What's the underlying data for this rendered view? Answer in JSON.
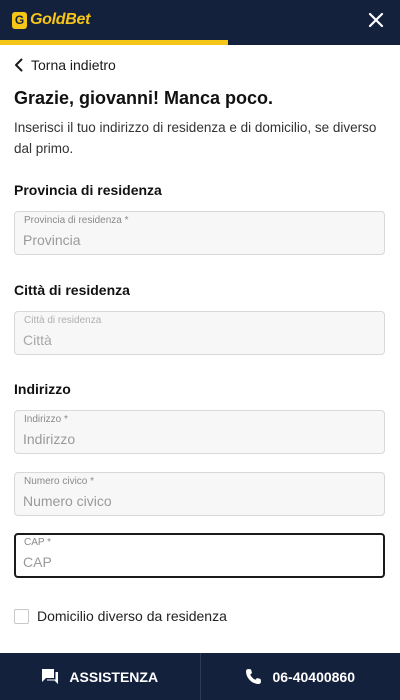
{
  "header": {
    "logo_badge": "G",
    "logo_text": "GoldBet",
    "progress_fraction": 0.57
  },
  "nav": {
    "back_label": "Torna indietro"
  },
  "intro": {
    "title": "Grazie, giovanni! Manca poco.",
    "subtitle": "Inserisci il tuo indirizzo di residenza e di domicilio, se diverso dal primo."
  },
  "sections": {
    "provincia": "Provincia di residenza",
    "citta": "Città di residenza",
    "indirizzo": "Indirizzo"
  },
  "fields": {
    "provincia": {
      "label": "Provincia di residenza *",
      "placeholder": "Provincia",
      "value": ""
    },
    "citta": {
      "label": "Città di residenza",
      "placeholder": "Città",
      "value": ""
    },
    "indirizzo": {
      "label": "Indirizzo *",
      "placeholder": "Indirizzo",
      "value": ""
    },
    "civico": {
      "label": "Numero civico *",
      "placeholder": "Numero civico",
      "value": ""
    },
    "cap": {
      "label": "CAP *",
      "placeholder": "CAP",
      "value": ""
    }
  },
  "checkbox": {
    "label": "Domicilio diverso da residenza",
    "checked": false
  },
  "footer": {
    "assist_label": "ASSISTENZA",
    "phone_label": "06-40400860"
  },
  "colors": {
    "navy": "#14213d",
    "gold": "#f5c518"
  },
  "icons": {
    "close": "close-icon",
    "back": "chevron-left-icon",
    "chat": "chat-icon",
    "phone": "phone-icon"
  }
}
